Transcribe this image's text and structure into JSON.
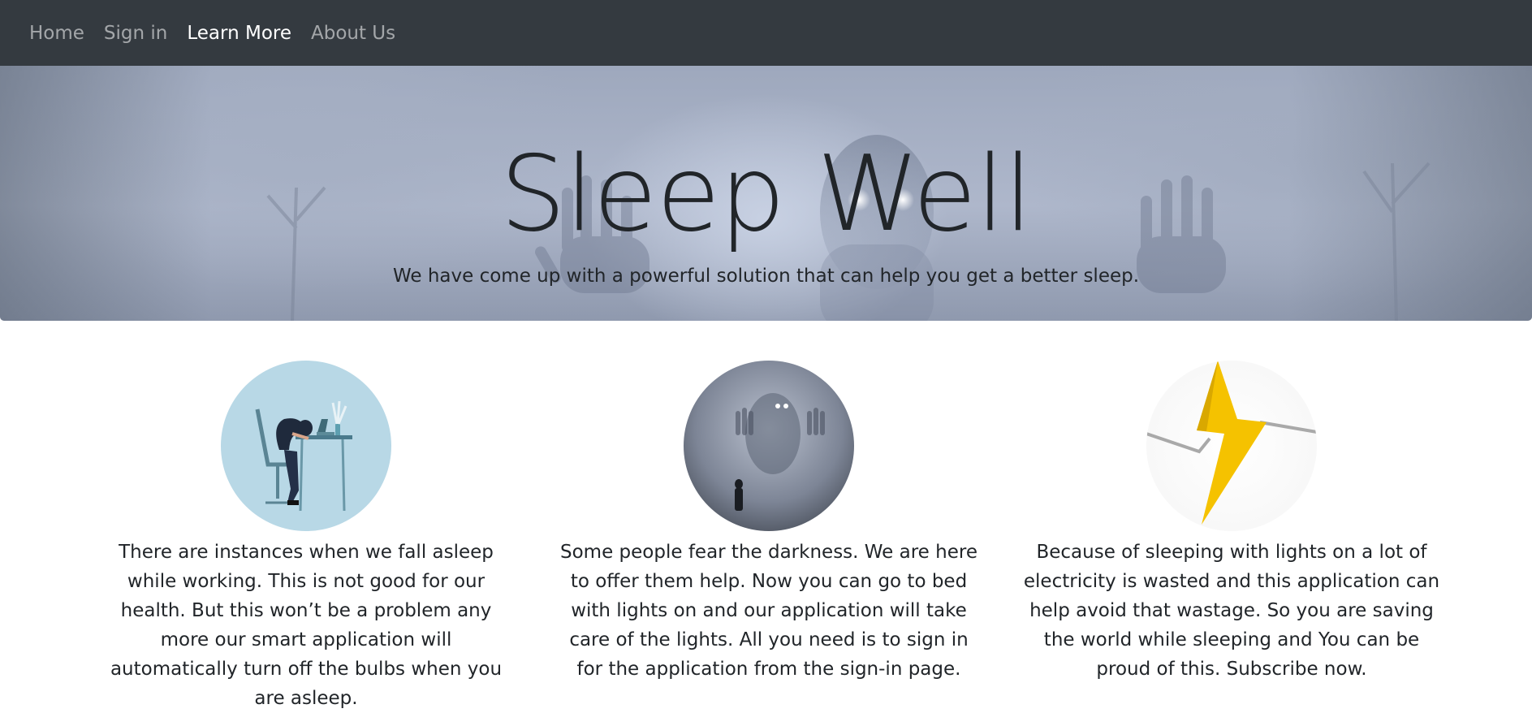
{
  "nav": {
    "items": [
      {
        "label": "Home",
        "active": false
      },
      {
        "label": "Sign in",
        "active": false
      },
      {
        "label": "Learn More",
        "active": true
      },
      {
        "label": "About Us",
        "active": false
      }
    ]
  },
  "hero": {
    "title": "Sleep Well",
    "subtitle": "We have come up with a powerful solution that can help you get a better sleep."
  },
  "features": [
    {
      "image": "sleeping-at-desk-illustration",
      "text": "There are instances when we fall asleep while working. This is not good for our health. But this won’t be a problem any more our smart application will automatically turn off the bulbs when you are asleep."
    },
    {
      "image": "ghost-in-fog-image",
      "text": "Some people fear the darkness. We are here to offer them help. Now you can go to bed with lights on and our application will take care of the lights. All you need is to sign in for the application from the sign-in page."
    },
    {
      "image": "lightning-bolt-image",
      "text": "Because of sleeping with lights on a lot of electricity is wasted and this application can help avoid that wastage. So you are saving the world while sleeping and You can be proud of this. Subscribe now."
    }
  ],
  "colors": {
    "navbar": "#343a40",
    "nav_active": "#ffffff",
    "nav_inactive": "rgba(255,255,255,0.55)",
    "text": "#212529",
    "bolt": "#f5c200"
  }
}
